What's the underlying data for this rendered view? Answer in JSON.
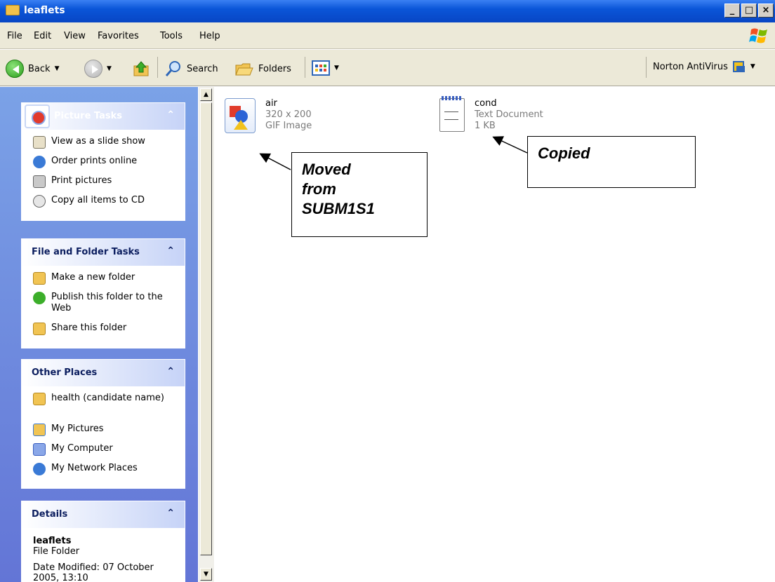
{
  "window": {
    "title": "leaflets"
  },
  "menu": [
    "File",
    "Edit",
    "View",
    "Favorites",
    "Tools",
    "Help"
  ],
  "toolbar": {
    "back": "Back",
    "search": "Search",
    "folders": "Folders",
    "norton": "Norton AntiVirus"
  },
  "picture_tasks": {
    "title": "Picture Tasks",
    "items": [
      "View as a slide show",
      "Order prints online",
      "Print pictures",
      "Copy all items to CD"
    ]
  },
  "file_folder_tasks": {
    "title": "File and Folder Tasks",
    "items": [
      "Make a new folder",
      "Publish this folder to the Web",
      "Share this folder"
    ]
  },
  "other_places": {
    "title": "Other Places",
    "items": [
      "health (candidate name)",
      "My Pictures",
      "My Computer",
      "My Network Places"
    ]
  },
  "details": {
    "title": "Details",
    "name": "leaflets",
    "type": "File Folder",
    "modified": "Date Modified: 07 October 2005, 13:10"
  },
  "files": [
    {
      "name": "air",
      "line2": "320 x 200",
      "line3": "GIF Image"
    },
    {
      "name": "cond",
      "line2": "Text Document",
      "line3": "1 KB"
    }
  ],
  "annotations": {
    "moved": [
      "Moved",
      "from",
      "SUBM1S1"
    ],
    "copied": "Copied"
  }
}
